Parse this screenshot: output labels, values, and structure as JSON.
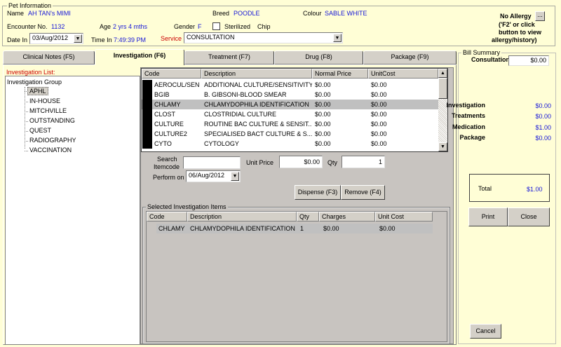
{
  "pet": {
    "section_label": "Pet Information",
    "name_label": "Name",
    "name": "AH TAN's MIMI",
    "breed_label": "Breed",
    "breed": "POODLE",
    "colour_label": "Colour",
    "colour": "SABLE WHITE",
    "encounter_label": "Encounter No.",
    "encounter": "1132",
    "age_label": "Age",
    "age": "2 yrs 4 mths",
    "gender_label": "Gender",
    "gender": "F",
    "sterilized_label": "Sterilized",
    "chip_label": "Chip",
    "date_in_label": "Date In",
    "date_in": "03/Aug/2012",
    "time_in_label": "Time In",
    "time_in": "7:49:39 PM",
    "service_label": "Service",
    "service": "CONSULTATION"
  },
  "allergy": {
    "title": "No Allergy",
    "btn": "...",
    "hint_lines": [
      "('F2' or click",
      "button to view",
      "allergy/history)"
    ]
  },
  "tabs": [
    {
      "label": "Clinical Notes (F5)"
    },
    {
      "label": "Investigation (F6)"
    },
    {
      "label": "Treatment (F7)"
    },
    {
      "label": "Drug (F8)"
    },
    {
      "label": "Package (F9)"
    }
  ],
  "investigation_list": {
    "title": "Investigation List:",
    "root": "Investigation Group",
    "groups": [
      "APHL",
      "IN-HOUSE",
      "MITCHVILLE",
      "OUTSTANDING",
      "QUEST",
      "RADIOGRAPHY",
      "VACCINATION"
    ]
  },
  "items_grid": {
    "headers": [
      "Code",
      "Description",
      "Normal Price",
      "UnitCost"
    ],
    "rows": [
      {
        "code": "AEROCUL/SEN",
        "desc": "ADDITIONAL CULTURE/SENSITIVITY",
        "price": "$0.00",
        "cost": "$0.00"
      },
      {
        "code": "BGIB",
        "desc": "B. GIBSONI-BLOOD SMEAR",
        "price": "$0.00",
        "cost": "$0.00"
      },
      {
        "code": "CHLAMY",
        "desc": "CHLAMYDOPHILA IDENTIFICATION",
        "price": "$0.00",
        "cost": "$0.00"
      },
      {
        "code": "CLOST",
        "desc": "CLOSTRIDIAL CULTURE",
        "price": "$0.00",
        "cost": "$0.00"
      },
      {
        "code": "CULTURE",
        "desc": "ROUTINE BAC CULTURE & SENSIT...",
        "price": "$0.00",
        "cost": "$0.00"
      },
      {
        "code": "CULTURE2",
        "desc": "SPECIALISED BACT CULTURE & S...",
        "price": "$0.00",
        "cost": "$0.00"
      },
      {
        "code": "CYTO",
        "desc": "CYTOLOGY",
        "price": "$0.00",
        "cost": "$0.00"
      }
    ]
  },
  "form": {
    "search_label_1": "Search",
    "search_label_2": "Itemcode",
    "search_value": "",
    "unit_price_label": "Unit Price",
    "unit_price": "$0.00",
    "qty_label": "Qty",
    "qty": "1",
    "perform_on_label": "Perform on",
    "perform_on": "06/Aug/2012",
    "dispense_label": "Dispense (F3)",
    "remove_label": "Remove (F4)"
  },
  "selected": {
    "title": "Selected Investigation Items",
    "headers": [
      "Code",
      "Description",
      "Qty",
      "Charges",
      "Unit Cost"
    ],
    "rows": [
      {
        "code": "CHLAMY",
        "desc": "CHLAMYDOPHILA IDENTIFICATION",
        "qty": "1",
        "charges": "$0.00",
        "cost": "$0.00"
      }
    ]
  },
  "bill": {
    "title": "Bill Summary",
    "consultation_label": "Consultation",
    "consultation": "$0.00",
    "investigation_label": "Investigation",
    "investigation": "$0.00",
    "treatments_label": "Treatments",
    "treatments": "$0.00",
    "medication_label": "Medication",
    "medication": "$1.00",
    "package_label": "Package",
    "package": "$0.00",
    "total_label": "Total",
    "total": "$1.00",
    "print_label": "Print",
    "close_label": "Close",
    "cancel_label": "Cancel"
  },
  "colors": {
    "value_blue": "#1616d8",
    "label_red": "#cc0000",
    "background": "#fffed6",
    "selected_row": "#c0c0c0"
  }
}
